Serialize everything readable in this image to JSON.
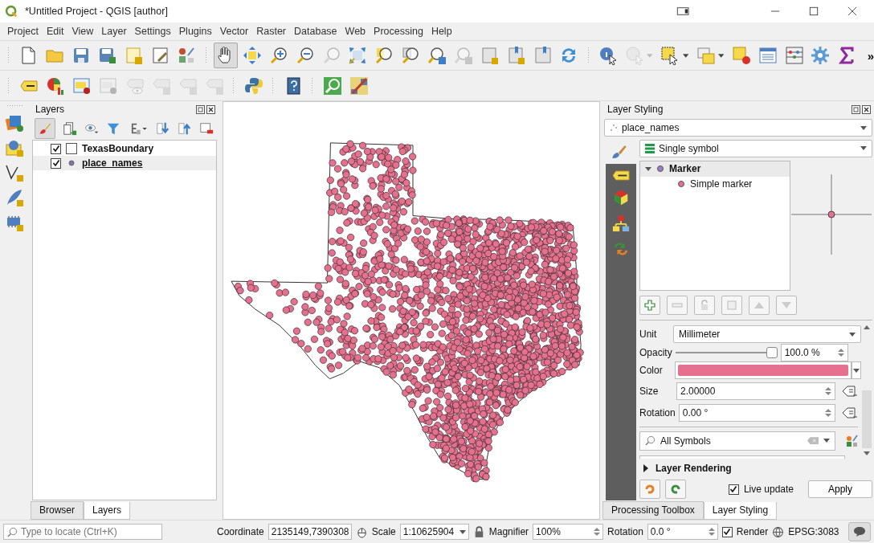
{
  "window": {
    "title": "*Untitled Project - QGIS [author]"
  },
  "menu": [
    {
      "label": "Project"
    },
    {
      "label": "Edit"
    },
    {
      "label": "View"
    },
    {
      "label": "Layer"
    },
    {
      "label": "Settings"
    },
    {
      "label": "Plugins"
    },
    {
      "label": "Vector"
    },
    {
      "label": "Raster"
    },
    {
      "label": "Database"
    },
    {
      "label": "Web"
    },
    {
      "label": "Processing"
    },
    {
      "label": "Help"
    }
  ],
  "toolbar_main": [
    {
      "kind": "new",
      "disabled": false,
      "pressed": false
    },
    {
      "kind": "open",
      "disabled": false,
      "pressed": false
    },
    {
      "kind": "save",
      "disabled": false,
      "pressed": false
    },
    {
      "kind": "saveas",
      "disabled": false,
      "pressed": false
    },
    {
      "kind": "layout",
      "disabled": false,
      "pressed": false
    },
    {
      "kind": "layoutmgr",
      "disabled": false,
      "pressed": false
    },
    {
      "kind": "stylemgr",
      "disabled": false,
      "pressed": false
    },
    {
      "kind": "sep"
    },
    {
      "kind": "pan",
      "disabled": false,
      "pressed": true
    },
    {
      "kind": "pansel",
      "disabled": false,
      "pressed": false
    },
    {
      "kind": "zoomin",
      "disabled": false,
      "pressed": false
    },
    {
      "kind": "zoomout",
      "disabled": false,
      "pressed": false
    },
    {
      "kind": "zoomnative",
      "disabled": true,
      "pressed": false
    },
    {
      "kind": "zoomfull",
      "disabled": false,
      "pressed": false
    },
    {
      "kind": "zoomsel",
      "disabled": false,
      "pressed": false
    },
    {
      "kind": "zoomlayer",
      "disabled": false,
      "pressed": false
    },
    {
      "kind": "zoomlast",
      "disabled": false,
      "pressed": false
    },
    {
      "kind": "zoomnext",
      "disabled": true,
      "pressed": false
    },
    {
      "kind": "bmnew",
      "disabled": false,
      "pressed": false
    },
    {
      "kind": "bmshow",
      "disabled": false,
      "pressed": false
    },
    {
      "kind": "bookmarks",
      "disabled": false,
      "pressed": false
    },
    {
      "kind": "refresh",
      "disabled": false,
      "pressed": false
    },
    {
      "kind": "sep"
    },
    {
      "kind": "identify",
      "disabled": false,
      "pressed": false
    },
    {
      "kind": "action",
      "disabled": true,
      "pressed": false
    },
    {
      "kind": "select",
      "disabled": false,
      "pressed": false
    },
    {
      "kind": "selectattr",
      "disabled": false,
      "pressed": false
    },
    {
      "kind": "deselect",
      "disabled": false,
      "pressed": false
    },
    {
      "kind": "table",
      "disabled": false,
      "pressed": false
    },
    {
      "kind": "stats",
      "disabled": false,
      "pressed": false
    },
    {
      "kind": "toolbox",
      "disabled": false,
      "pressed": false
    },
    {
      "kind": "sigma",
      "disabled": false,
      "pressed": false
    }
  ],
  "toolbar_overflow": "»",
  "toolbar_labels": [
    {
      "kind": "label",
      "disabled": false
    },
    {
      "kind": "diagram",
      "disabled": false
    },
    {
      "kind": "labelpin",
      "disabled": false
    },
    {
      "kind": "labelpin",
      "disabled": true
    },
    {
      "kind": "labelshow",
      "disabled": true
    },
    {
      "kind": "labelmove",
      "disabled": true
    },
    {
      "kind": "labelrotate",
      "disabled": true
    },
    {
      "kind": "labeledit",
      "disabled": true
    },
    {
      "kind": "sep"
    },
    {
      "kind": "python",
      "disabled": false
    },
    {
      "kind": "sep"
    },
    {
      "kind": "help",
      "disabled": false
    },
    {
      "kind": "sep"
    },
    {
      "kind": "locator",
      "disabled": false
    },
    {
      "kind": "mapstyle",
      "disabled": false
    }
  ],
  "layers_panel": {
    "title": "Layers",
    "layers": [
      {
        "name": "TexasBoundary",
        "kind": "polygon",
        "checked": true,
        "selected": false
      },
      {
        "name": "place_names",
        "kind": "point",
        "checked": true,
        "selected": true
      }
    ],
    "tabs": [
      {
        "label": "Browser",
        "selected": false
      },
      {
        "label": "Layers",
        "selected": true
      }
    ]
  },
  "styling_panel": {
    "title": "Layer Styling",
    "layer": "place_names",
    "renderer": "Single symbol",
    "symbol_tree": [
      {
        "label": "Marker",
        "kind": "symbol",
        "expanded": true,
        "selected": true,
        "children": [
          {
            "label": "Simple marker",
            "kind": "layer",
            "selected": false
          }
        ]
      }
    ],
    "unit": {
      "label": "Unit",
      "value": "Millimeter"
    },
    "opacity": {
      "label": "Opacity",
      "level": 1.0,
      "value": "100.0 %"
    },
    "color": {
      "label": "Color",
      "color": "#e5718e"
    },
    "size": {
      "label": "Size",
      "value": "2.00000"
    },
    "rotation": {
      "label": "Rotation",
      "value": "0.00 °"
    },
    "symbol_search": {
      "value": "All Symbols"
    },
    "layer_rendering": {
      "label": "Layer Rendering",
      "expanded": false
    },
    "live_update": {
      "label": "Live update",
      "checked": true
    },
    "apply": "Apply",
    "tabs": [
      {
        "label": "Processing Toolbox",
        "selected": false
      },
      {
        "label": "Layer Styling",
        "selected": true
      }
    ]
  },
  "status_bar": {
    "locate_placeholder": "Type to locate (Ctrl+K)",
    "coordinate_label": "Coordinate",
    "coordinate": "2135149,7390308",
    "scale_label": "Scale",
    "scale": "1:10625904",
    "magnifier_label": "Magnifier",
    "magnifier": "100%",
    "rotation_label": "Rotation",
    "rotation": "0.0 °",
    "render": {
      "label": "Render",
      "checked": true
    },
    "crs": "EPSG:3083"
  }
}
